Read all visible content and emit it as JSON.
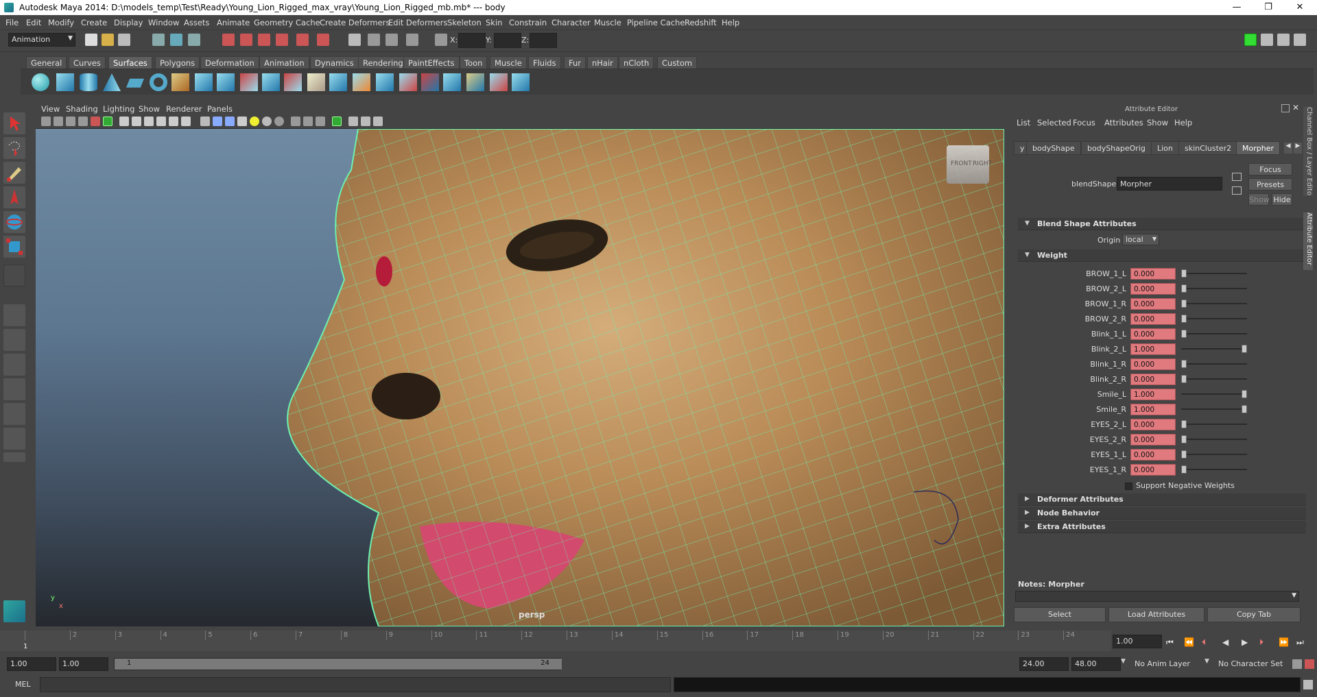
{
  "titlebar": {
    "title": "Autodesk Maya 2014: D:\\models_temp\\Test\\Ready\\Young_Lion_Rigged_max_vray\\Young_Lion_Rigged_mb.mb*  ---  body",
    "minimize": "—",
    "restore": "❐",
    "close": "✕"
  },
  "menubar": [
    "File",
    "Edit",
    "Modify",
    "Create",
    "Display",
    "Window",
    "Assets",
    "Animate",
    "Geometry Cache",
    "Create Deformers",
    "Edit Deformers",
    "Skeleton",
    "Skin",
    "Constrain",
    "Character",
    "Muscle",
    "Pipeline Cache",
    "Redshift",
    "Help"
  ],
  "statusline": {
    "mode": "Animation",
    "x_label": "X:",
    "y_label": "Y:",
    "z_label": "Z:"
  },
  "shelf_tabs": [
    "General",
    "Curves",
    "Surfaces",
    "Polygons",
    "Deformation",
    "Animation",
    "Dynamics",
    "Rendering",
    "PaintEffects",
    "Toon",
    "Muscle",
    "Fluids",
    "Fur",
    "nHair",
    "nCloth",
    "Custom"
  ],
  "shelf_active": "Surfaces",
  "viewport": {
    "menu": [
      "View",
      "Shading",
      "Lighting",
      "Show",
      "Renderer",
      "Panels"
    ],
    "camera": "persp",
    "viewcube_front": "FRONT",
    "viewcube_right": "RIGHT",
    "axis_y": "y",
    "axis_x": "x"
  },
  "attribute_editor": {
    "title": "Attribute Editor",
    "menu": [
      "List",
      "Selected",
      "Focus",
      "Attributes",
      "Show",
      "Help"
    ],
    "tabs": [
      "y",
      "bodyShape",
      "bodyShapeOrig",
      "Lion",
      "skinCluster2",
      "Morpher"
    ],
    "active_tab": "Morpher",
    "node_label": "blendShape:",
    "node_value": "Morpher",
    "focus_button": "Focus",
    "presets_button": "Presets",
    "show_button": "Show",
    "hide_button": "Hide",
    "sections": {
      "blend_shape": "Blend Shape Attributes",
      "origin_label": "Origin",
      "origin_value": "local",
      "weight": "Weight",
      "deformer": "Deformer Attributes",
      "node_behavior": "Node Behavior",
      "extra": "Extra Attributes"
    },
    "weights": [
      {
        "name": "BROW_1_L",
        "value": "0.000",
        "level": 0
      },
      {
        "name": "BROW_2_L",
        "value": "0.000",
        "level": 0
      },
      {
        "name": "BROW_1_R",
        "value": "0.000",
        "level": 0
      },
      {
        "name": "BROW_2_R",
        "value": "0.000",
        "level": 0
      },
      {
        "name": "Blink_1_L",
        "value": "0.000",
        "level": 0
      },
      {
        "name": "Blink_2_L",
        "value": "1.000",
        "level": 1
      },
      {
        "name": "Blink_1_R",
        "value": "0.000",
        "level": 0
      },
      {
        "name": "Blink_2_R",
        "value": "0.000",
        "level": 0
      },
      {
        "name": "Smile_L",
        "value": "1.000",
        "level": 1
      },
      {
        "name": "Smile_R",
        "value": "1.000",
        "level": 1
      },
      {
        "name": "EYES_2_L",
        "value": "0.000",
        "level": 0
      },
      {
        "name": "EYES_2_R",
        "value": "0.000",
        "level": 0
      },
      {
        "name": "EYES_1_L",
        "value": "0.000",
        "level": 0
      },
      {
        "name": "EYES_1_R",
        "value": "0.000",
        "level": 0
      }
    ],
    "support_negative": "Support Negative Weights",
    "notes_label": "Notes:  Morpher",
    "select_button": "Select",
    "load_button": "Load Attributes",
    "copy_button": "Copy Tab",
    "side_tab_1": "Channel Box / Layer Editor",
    "side_tab_2": "Attribute Editor"
  },
  "timeline": {
    "frames": [
      "1",
      "2",
      "3",
      "4",
      "5",
      "6",
      "7",
      "8",
      "9",
      "10",
      "11",
      "12",
      "13",
      "14",
      "15",
      "16",
      "17",
      "18",
      "19",
      "20",
      "21",
      "22",
      "23",
      "24"
    ],
    "current_frame": "1",
    "current_field": "1.00"
  },
  "range": {
    "start": "1.00",
    "start2": "1.00",
    "range_start": "1",
    "range_end": "24",
    "end": "24.00",
    "end2": "48.00",
    "anim_layer": "No Anim Layer",
    "char_set": "No Character Set"
  },
  "cmd": {
    "label": "MEL"
  }
}
